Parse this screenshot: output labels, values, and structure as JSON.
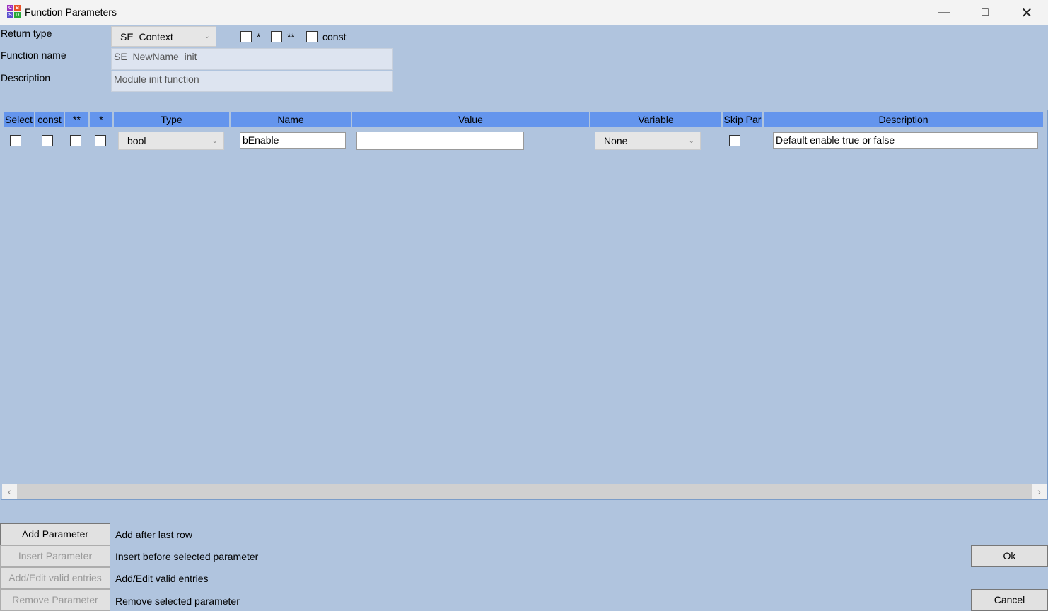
{
  "window": {
    "title": "Function Parameters",
    "logo_letters": [
      "C",
      "B",
      "S",
      "D"
    ]
  },
  "form": {
    "return_type_label": "Return type",
    "return_type_value": "SE_Context",
    "ptr_label": "*",
    "dptr_label": "**",
    "const_label": "const",
    "function_name_label": "Function name",
    "function_name_value": "SE_NewName_init",
    "description_label": "Description",
    "description_value": "Module init function"
  },
  "table": {
    "headers": [
      "Select",
      "const",
      "**",
      "*",
      "Type",
      "Name",
      "Value",
      "Variable",
      "Skip Par",
      "Description"
    ],
    "rows": [
      {
        "type": "bool",
        "name": "bEnable",
        "value": "",
        "variable": "None",
        "description": "Default enable true or false"
      }
    ]
  },
  "buttons": [
    {
      "label": "Add Parameter",
      "hint": "Add after last row"
    },
    {
      "label": "Insert Parameter",
      "hint": "Insert before selected parameter"
    },
    {
      "label": "Add/Edit valid entries",
      "hint": "Add/Edit valid entries"
    },
    {
      "label": "Remove Parameter",
      "hint": "Remove selected parameter"
    }
  ],
  "ok_label": "Ok",
  "cancel_label": "Cancel"
}
